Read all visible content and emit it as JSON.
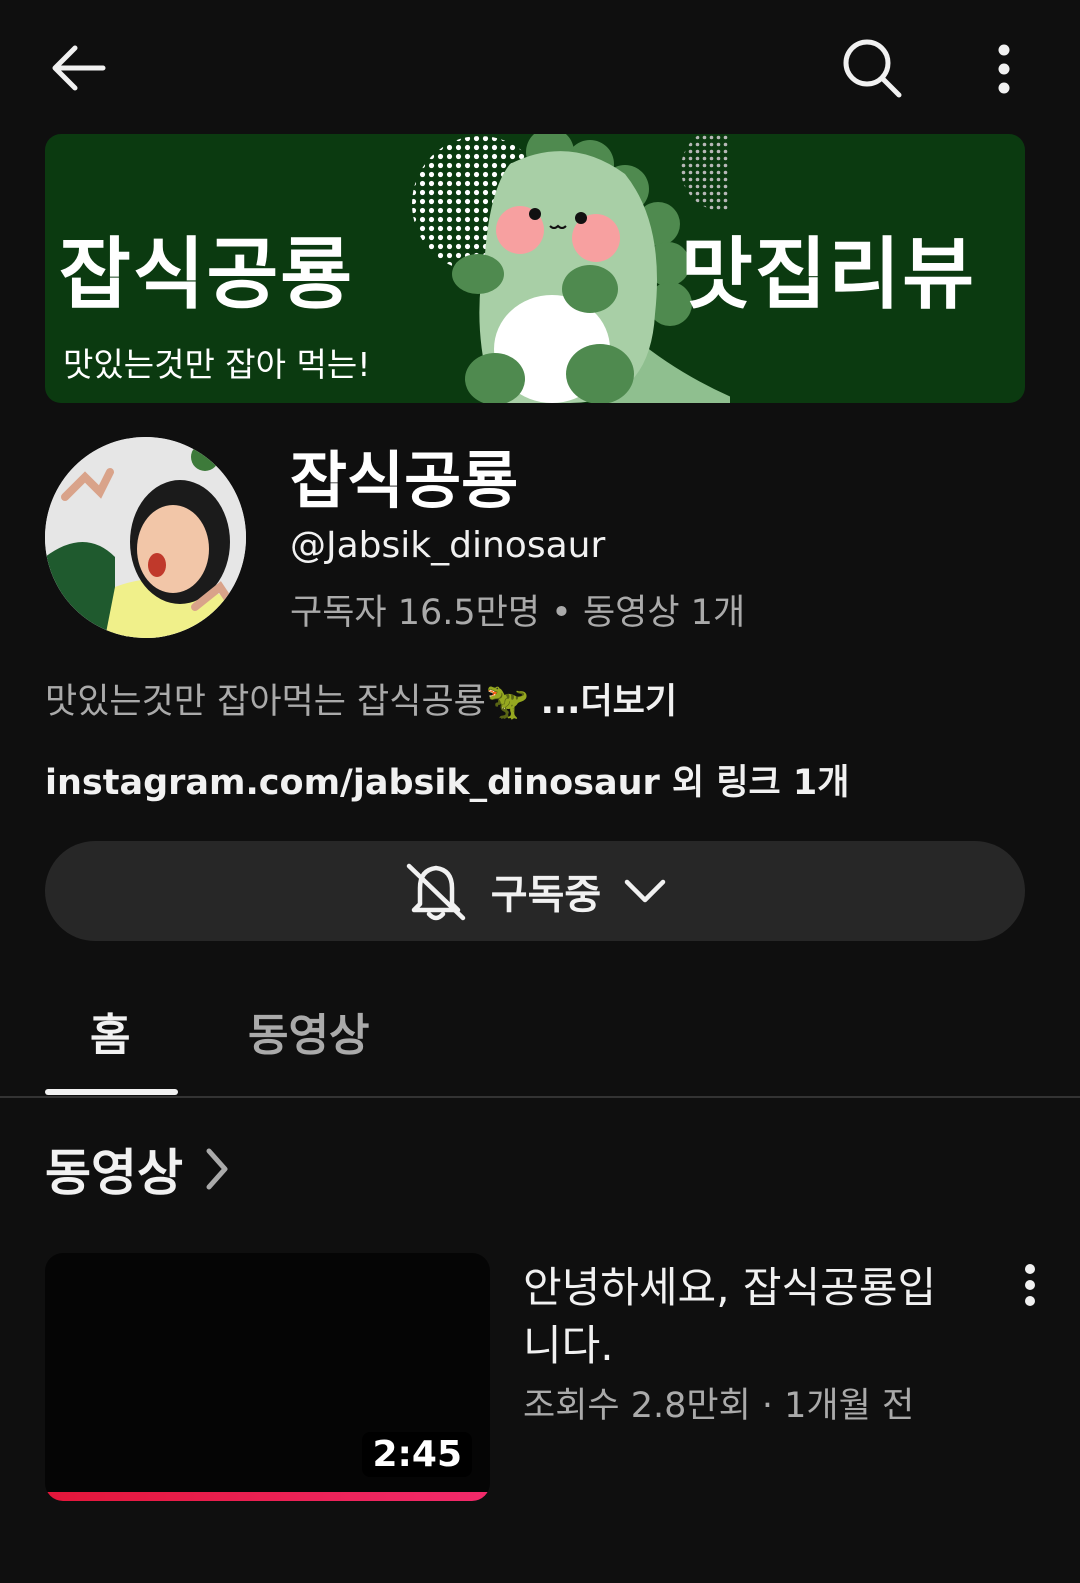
{
  "topbar": {
    "back_icon": "arrow-left-icon",
    "search_icon": "search-icon",
    "more_icon": "more-vert-icon"
  },
  "banner": {
    "left_title": "잡식공룡",
    "subtitle": "맛있는것만 잡아 먹는!",
    "right_title": "맛집리뷰",
    "bg_color": "#0b3a10"
  },
  "channel": {
    "name": "잡식공룡",
    "handle": "@Jabsik_dinosaur",
    "stats": "구독자 16.5만명 • 동영상 1개",
    "description": "맛있는것만 잡아먹는 잡식공룡🦖",
    "more_label": "...더보기",
    "links": "instagram.com/jabsik_dinosaur 외 링크 1개"
  },
  "subscribe": {
    "label": "구독중",
    "bell_icon": "bell-off-icon",
    "chevron_icon": "chevron-down-icon"
  },
  "tabs": [
    {
      "label": "홈",
      "active": true
    },
    {
      "label": "동영상",
      "active": false
    }
  ],
  "section": {
    "title": "동영상",
    "chevron_icon": "chevron-right-icon"
  },
  "video": {
    "title": "안녕하세요, 잡식공룡입니다.",
    "meta": "조회수 2.8만회 · 1개월 전",
    "duration": "2:45",
    "watched_fraction": 1.0,
    "progress_color": "#e4163a"
  }
}
